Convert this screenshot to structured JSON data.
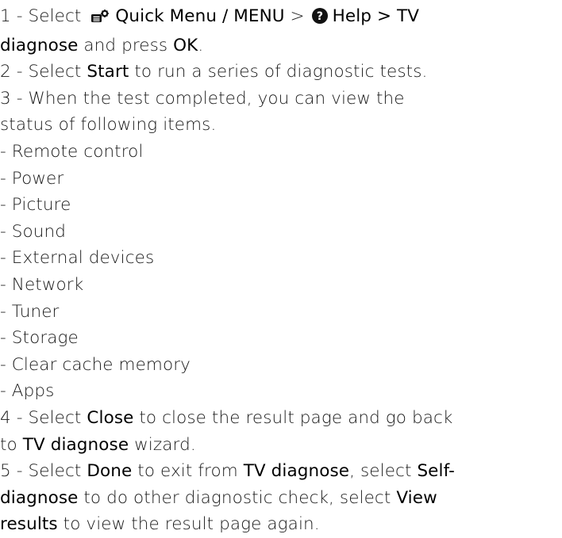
{
  "steps": {
    "s1": {
      "num": "1 - ",
      "t1": "Select ",
      "quick_menu": "Quick Menu / MENU",
      "sep1": " > ",
      "help": "Help",
      "sep2": " > TV",
      "tv_diagnose": "diagnose",
      "t2": " and press ",
      "ok": "OK",
      "t3": "."
    },
    "s2": {
      "num": "2 - ",
      "t1": "Select ",
      "start": "Start",
      "t2": " to run a series of diagnostic tests."
    },
    "s3": {
      "num": "3 - ",
      "line1": "When the test completed, you can view the",
      "line2": "status of following items."
    },
    "items": [
      "- Remote control",
      "- Power",
      "- Picture",
      "- Sound",
      "- External devices",
      "- Network",
      "- Tuner",
      "- Storage",
      "- Clear cache memory",
      "- Apps"
    ],
    "s4": {
      "num": "4 - ",
      "t1": "Select ",
      "close": "Close",
      "t2": " to close the result page and go back",
      "t3": "to ",
      "tv_diagnose": "TV diagnose",
      "t4": " wizard."
    },
    "s5": {
      "num": "5 - ",
      "t1": "Select ",
      "done": "Done",
      "t2": " to exit from ",
      "tv_diagnose": "TV diagnose",
      "t3": ", select ",
      "self1": "Self-",
      "self2": "diagnose",
      "t4": " to do other diagnostic check, select ",
      "view1": "View",
      "view2": "results",
      "t5": " to view the result page again."
    }
  },
  "icons": {
    "quick_menu": "quick-menu-icon",
    "help": "help-icon"
  }
}
